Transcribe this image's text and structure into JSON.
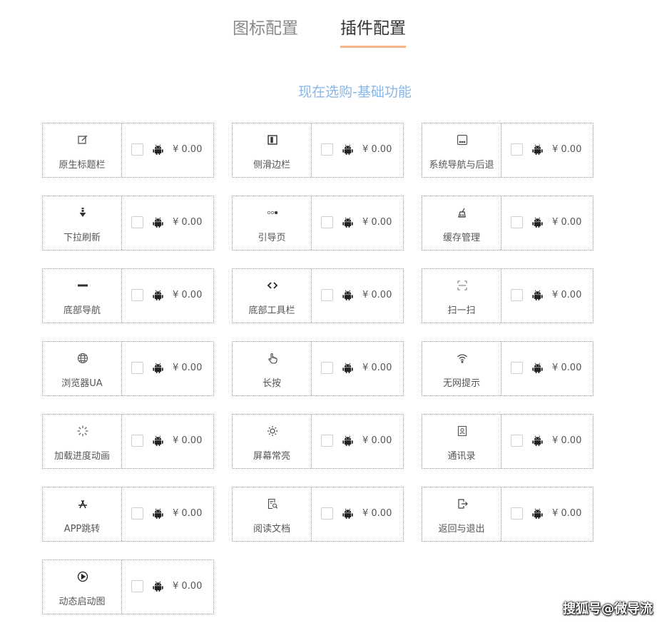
{
  "tabs": [
    {
      "label": "图标配置",
      "active": false
    },
    {
      "label": "插件配置",
      "active": true
    }
  ],
  "section_title": "现在选购-基础功能",
  "accent_color": "#f6b58a",
  "title_color": "#8ab7e8",
  "plugins": [
    {
      "name": "原生标题栏",
      "icon": "edit-icon",
      "price": "¥ 0.00",
      "checked": false
    },
    {
      "name": "侧滑边栏",
      "icon": "sidebar-icon",
      "price": "¥ 0.00",
      "checked": false
    },
    {
      "name": "系统导航与后退",
      "icon": "nav-bar-icon",
      "price": "¥ 0.00",
      "checked": false
    },
    {
      "name": "下拉刷新",
      "icon": "arrow-down-icon",
      "price": "¥ 0.00",
      "checked": false
    },
    {
      "name": "引导页",
      "icon": "dots-icon",
      "price": "¥ 0.00",
      "checked": false
    },
    {
      "name": "缓存管理",
      "icon": "broom-icon",
      "price": "¥ 0.00",
      "checked": false
    },
    {
      "name": "底部导航",
      "icon": "bottom-nav-icon",
      "price": "¥ 0.00",
      "checked": false
    },
    {
      "name": "底部工具栏",
      "icon": "code-icon",
      "price": "¥ 0.00",
      "checked": false
    },
    {
      "name": "扫一扫",
      "icon": "scan-icon",
      "price": "¥ 0.00",
      "checked": false
    },
    {
      "name": "浏览器UA",
      "icon": "globe-icon",
      "price": "¥ 0.00",
      "checked": false
    },
    {
      "name": "长按",
      "icon": "hand-pointer-icon",
      "price": "¥ 0.00",
      "checked": false
    },
    {
      "name": "无网提示",
      "icon": "wifi-icon",
      "price": "¥ 0.00",
      "checked": false
    },
    {
      "name": "加载进度动画",
      "icon": "spinner-icon",
      "price": "¥ 0.00",
      "checked": false
    },
    {
      "name": "屏幕常亮",
      "icon": "sun-icon",
      "price": "¥ 0.00",
      "checked": false
    },
    {
      "name": "通讯录",
      "icon": "contacts-icon",
      "price": "¥ 0.00",
      "checked": false
    },
    {
      "name": "APP跳转",
      "icon": "app-store-icon",
      "price": "¥ 0.00",
      "checked": false
    },
    {
      "name": "阅读文档",
      "icon": "document-search-icon",
      "price": "¥ 0.00",
      "checked": false
    },
    {
      "name": "返回与退出",
      "icon": "exit-icon",
      "price": "¥ 0.00",
      "checked": false
    },
    {
      "name": "动态启动图",
      "icon": "play-icon",
      "price": "¥ 0.00",
      "checked": false
    }
  ],
  "watermark": "搜狐号@微导流"
}
